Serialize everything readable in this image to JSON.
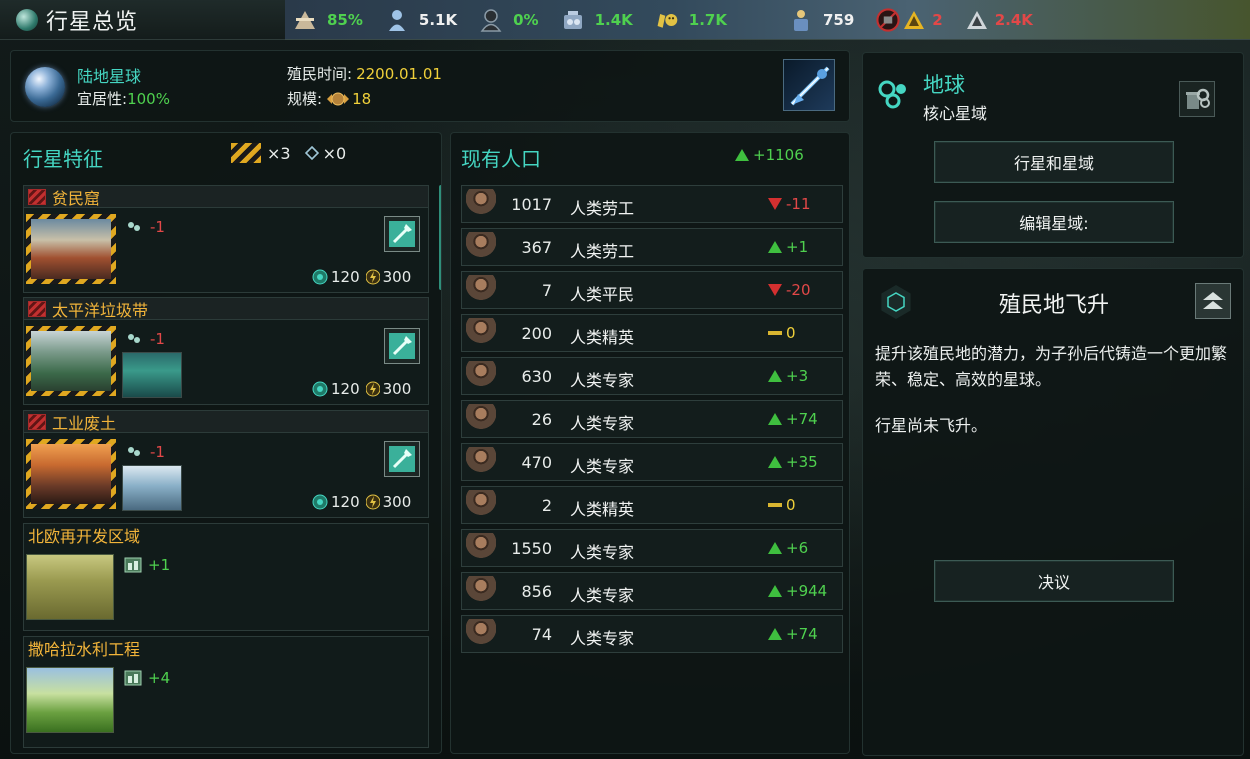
{
  "window": {
    "title": "行星总览"
  },
  "resources": [
    {
      "icon": "stability-icon",
      "value": "85%",
      "color": "green"
    },
    {
      "icon": "population-icon",
      "value": "5.1K",
      "color": "white"
    },
    {
      "icon": "unemployment-icon",
      "value": "0%",
      "color": "green"
    },
    {
      "icon": "minerals-icon",
      "value": "1.4K",
      "color": "green"
    },
    {
      "icon": "amenities-icon",
      "value": "1.7K",
      "color": "green"
    },
    {
      "icon": "housing-icon",
      "value": "759",
      "color": "white"
    },
    {
      "icon": "crime-icon",
      "value": "2",
      "color": "red"
    },
    {
      "icon": "building-slots-icon",
      "value": "2.4K",
      "color": "red"
    }
  ],
  "planet": {
    "type": "陆地星球",
    "habitability_label": "宜居性:",
    "habitability_value": "100%",
    "colonized_label": "殖民时间:",
    "colonized_value": "2200.01.01",
    "size_label": "规模:",
    "size_value": "18"
  },
  "traits": {
    "title": "行星特征",
    "blocker_count": "×3",
    "feature_count": "×0",
    "items": [
      {
        "name": "贫民窟",
        "effect": "-1",
        "cost_energy": "120",
        "cost_power": "300",
        "blocker": true
      },
      {
        "name": "太平洋垃圾带",
        "effect": "-1",
        "cost_energy": "120",
        "cost_power": "300",
        "blocker": true
      },
      {
        "name": "工业废土",
        "effect": "-1",
        "cost_energy": "120",
        "cost_power": "300",
        "blocker": true
      },
      {
        "name": "北欧再开发区域",
        "effect": "+1",
        "blocker": false
      },
      {
        "name": "撒哈拉水利工程",
        "effect": "+4",
        "blocker": false
      }
    ]
  },
  "population": {
    "title": "现有人口",
    "growth": "+1106",
    "rows": [
      {
        "count": "1017",
        "name": "人类劳工",
        "delta": "-11",
        "trend": "down"
      },
      {
        "count": "367",
        "name": "人类劳工",
        "delta": "+1",
        "trend": "up"
      },
      {
        "count": "7",
        "name": "人类平民",
        "delta": "-20",
        "trend": "down"
      },
      {
        "count": "200",
        "name": "人类精英",
        "delta": "0",
        "trend": "flat"
      },
      {
        "count": "630",
        "name": "人类专家",
        "delta": "+3",
        "trend": "up"
      },
      {
        "count": "26",
        "name": "人类专家",
        "delta": "+74",
        "trend": "up"
      },
      {
        "count": "470",
        "name": "人类专家",
        "delta": "+35",
        "trend": "up"
      },
      {
        "count": "2",
        "name": "人类精英",
        "delta": "0",
        "trend": "flat"
      },
      {
        "count": "1550",
        "name": "人类专家",
        "delta": "+6",
        "trend": "up"
      },
      {
        "count": "856",
        "name": "人类专家",
        "delta": "+944",
        "trend": "up"
      },
      {
        "count": "74",
        "name": "人类专家",
        "delta": "+74",
        "trend": "up"
      }
    ]
  },
  "sector": {
    "name": "地球",
    "subtitle": "核心星域",
    "btn_planets": "行星和星域",
    "btn_edit": "编辑星域:"
  },
  "ascension": {
    "title": "殖民地飞升",
    "description": "提升该殖民地的潜力，为子孙后代铸造一个更加繁荣、稳定、高效的星球。",
    "status": "行星尚未飞升。",
    "btn_resolve": "决议"
  },
  "colors": {
    "accent": "#45d6c2",
    "positive": "#4fd14f",
    "negative": "#e24848",
    "trait_name": "#f2b43a"
  }
}
